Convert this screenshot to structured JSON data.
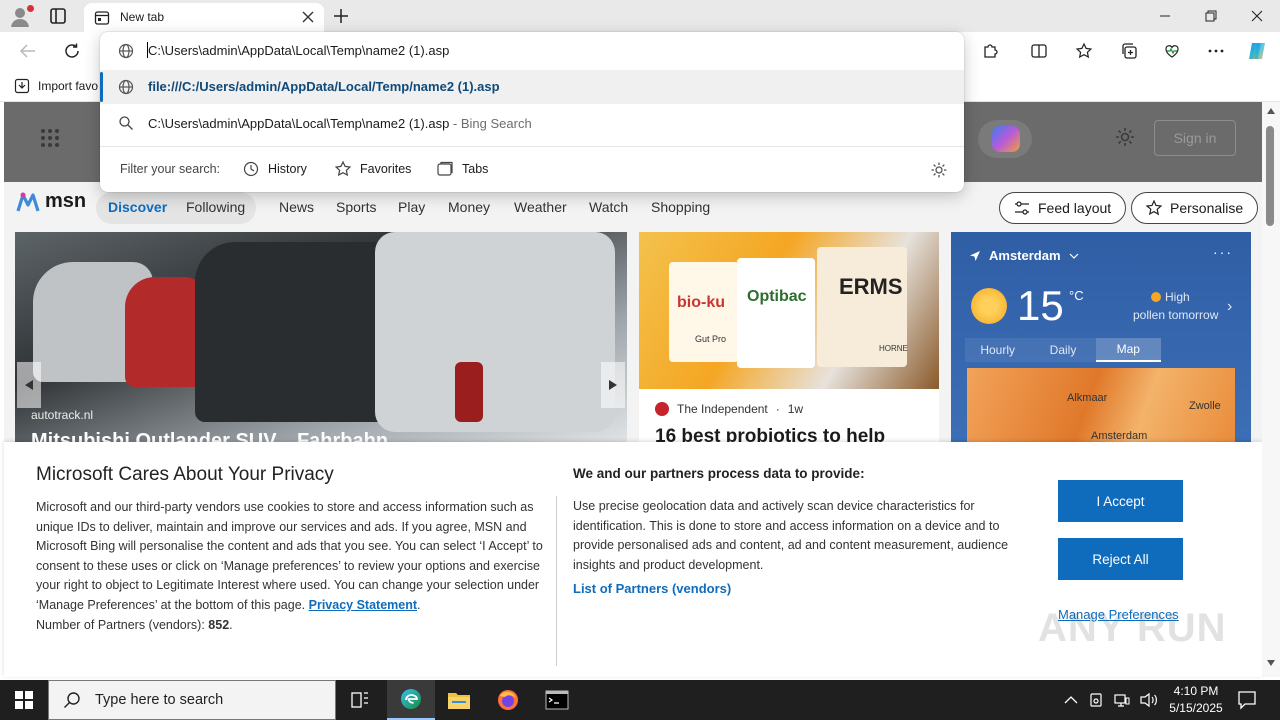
{
  "browser": {
    "tab_title": "New tab",
    "favorites_bar": {
      "import_label": "Import favo"
    }
  },
  "omnibox": {
    "input_value": "C:\\Users\\admin\\AppData\\Local\\Temp\\name2 (1).asp",
    "suggestions": [
      {
        "text": "file:///C:/Users/admin/AppData/Local/Temp/name2 (1).asp",
        "icon": "globe-icon"
      },
      {
        "text": "C:\\Users\\admin\\AppData\\Local\\Temp\\name2 (1).asp",
        "suffix": " - Bing Search",
        "icon": "search-icon"
      }
    ],
    "filter_label": "Filter your search:",
    "filters": [
      "History",
      "Favorites",
      "Tabs"
    ]
  },
  "msn": {
    "signin_label": "Sign in",
    "logo_text": "msn",
    "nav": [
      "Discover",
      "Following",
      "News",
      "Sports",
      "Play",
      "Money",
      "Weather",
      "Watch",
      "Shopping"
    ],
    "active_nav": "Discover",
    "feed_layout_label": "Feed layout",
    "personalise_label": "Personalise",
    "hero": {
      "source": "autotrack.nl",
      "title": "Mitsubishi Outlander SUV... Fahrbahn..."
    },
    "news_card": {
      "image_labels": [
        "bio-ku",
        "Optibac",
        "ERMS",
        "Gut Pro",
        "HORNE"
      ],
      "source": "The Independent",
      "age": "1w",
      "title": "16 best probiotics to help"
    },
    "weather": {
      "location": "Amsterdam",
      "temperature": "15",
      "unit": "°C",
      "pollen_line1": "High",
      "pollen_line2": "pollen tomorrow",
      "tabs": [
        "Hourly",
        "Daily",
        "Map"
      ],
      "selected_tab": "Map",
      "map_cities": [
        "Alkmaar",
        "Zwolle",
        "Amsterdam"
      ]
    }
  },
  "consent": {
    "title": "Microsoft Cares About Your Privacy",
    "body": "Microsoft and our third-party vendors use cookies to store and access information such as unique IDs to deliver, maintain and improve our services and ads. If you agree, MSN and Microsoft Bing will personalise the content and ads that you see. You can select ‘I Accept’ to consent to these uses or click on ‘Manage preferences’ to review your options and exercise your right to object to Legitimate Interest where used.  You can change your selection under ‘Manage Preferences’ at the bottom of this page.",
    "privacy_link": "Privacy Statement",
    "partners_count_label": "Number of Partners (vendors):",
    "partners_count": "852",
    "right_title": "We and our partners process data to provide:",
    "right_body": "Use precise geolocation data and actively scan device characteristics for identification. This is done to store and access information on a device and to provide personalised ads and content, ad and content measurement, audience insights and product development.",
    "partners_link": "List of Partners (vendors)",
    "accept_label": "I Accept",
    "reject_label": "Reject All",
    "manage_label": "Manage Preferences",
    "watermark": "ANY RUN"
  },
  "taskbar": {
    "search_placeholder": "Type here to search",
    "time": "4:10 PM",
    "date": "5/15/2025"
  }
}
